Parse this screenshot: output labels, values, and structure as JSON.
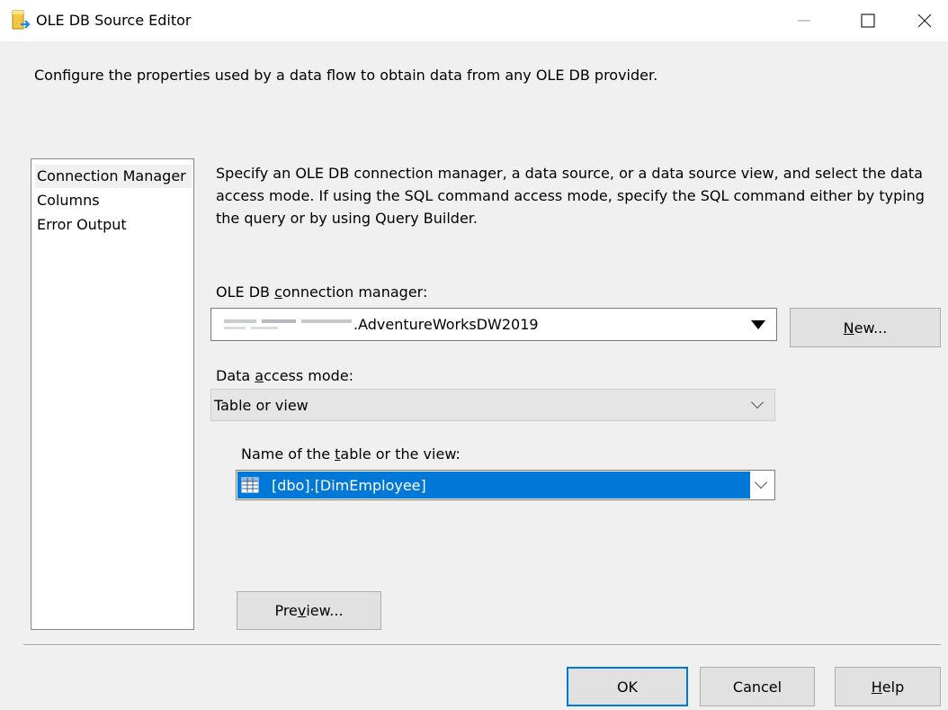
{
  "window": {
    "title": "OLE DB Source Editor",
    "icon": "ssis-source-icon",
    "controls": [
      "minimize-icon",
      "maximize-icon",
      "close-icon"
    ]
  },
  "description": "Configure the properties used by a data flow to obtain data from any OLE DB provider.",
  "nav": {
    "items": [
      {
        "label": "Connection Manager",
        "selected": true
      },
      {
        "label": "Columns",
        "selected": false
      },
      {
        "label": "Error Output",
        "selected": false
      }
    ]
  },
  "instructions": "Specify an OLE DB connection manager, a data source, or a data source view, and select the data access mode. If using the SQL command access mode, specify the SQL command either by typing the query or by using Query Builder.",
  "connection": {
    "label_pre": "OLE DB ",
    "label_key": "c",
    "label_post": "onnection manager:",
    "value": ".AdventureWorksDW2019",
    "new_label_key": "N",
    "new_label_post": "ew..."
  },
  "access_mode": {
    "label_pre": "Data ",
    "label_key": "a",
    "label_post": "ccess mode:",
    "value": "Table or view"
  },
  "table": {
    "label_pre": "Name of the ",
    "label_key": "t",
    "label_post": "able or the view:",
    "value": "[dbo].[DimEmployee]"
  },
  "preview": {
    "label_pre": "Pre",
    "label_key": "v",
    "label_post": "iew..."
  },
  "buttons": {
    "ok": "OK",
    "cancel": "Cancel",
    "help_key": "H",
    "help_post": "elp"
  },
  "colors": {
    "selection": "#0078d7",
    "dialog_bg": "#f0f0f0"
  }
}
